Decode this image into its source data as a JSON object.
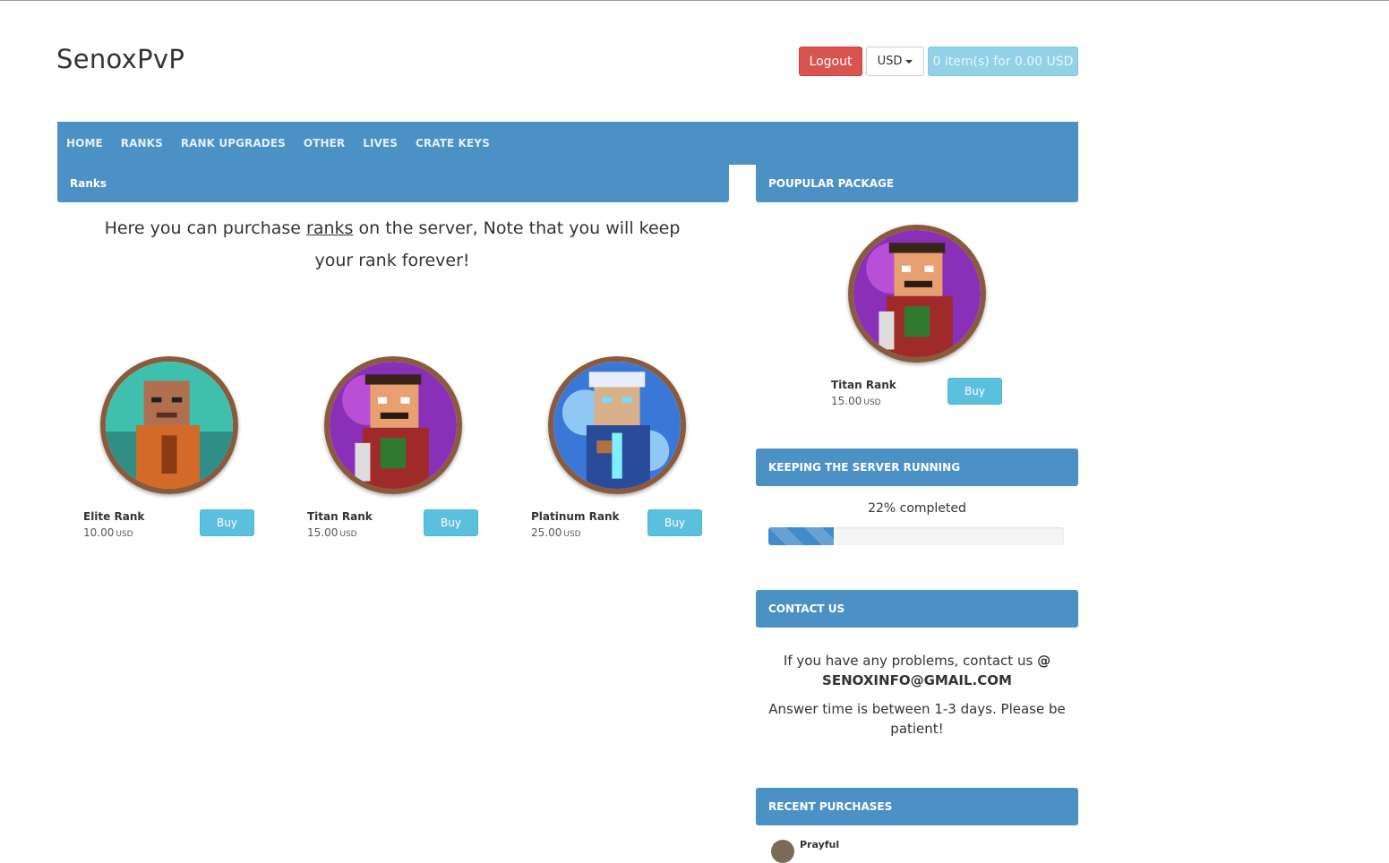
{
  "site": {
    "title": "SenoxPvP"
  },
  "header": {
    "logout_label": "Logout",
    "currency": "USD",
    "cart_label": "0 item(s) for 0.00 USD"
  },
  "nav": {
    "items": [
      {
        "label": "HOME"
      },
      {
        "label": "RANKS"
      },
      {
        "label": "RANK UPGRADES"
      },
      {
        "label": "OTHER"
      },
      {
        "label": "LIVES"
      },
      {
        "label": "CRATE KEYS"
      }
    ]
  },
  "main": {
    "heading": "Ranks",
    "intro_before": "Here you can purchase ",
    "intro_link": "ranks",
    "intro_after": " on the server, Note that you will keep your rank forever!",
    "packages": [
      {
        "name": "Elite Rank",
        "price": "10.00",
        "currency": "USD",
        "buy_label": "Buy",
        "icon": "elite-rank-icon"
      },
      {
        "name": "Titan Rank",
        "price": "15.00",
        "currency": "USD",
        "buy_label": "Buy",
        "icon": "titan-rank-icon"
      },
      {
        "name": "Platinum Rank",
        "price": "25.00",
        "currency": "USD",
        "buy_label": "Buy",
        "icon": "platinum-rank-icon"
      }
    ]
  },
  "sidebar": {
    "popular": {
      "heading": "POUPULAR PACKAGE",
      "name": "Titan Rank",
      "price": "15.00",
      "currency": "USD",
      "buy_label": "Buy"
    },
    "goal": {
      "heading": "KEEPING THE SERVER RUNNING",
      "label": "22% completed",
      "percent": 22
    },
    "contact": {
      "heading": "CONTACT US",
      "line1": "If you have any problems, contact us",
      "at": "@",
      "email": "SENOXINFO@GMAIL.COM",
      "line2": "Answer time is between 1-3 days. Please be patient!"
    },
    "recent": {
      "heading": "RECENT PURCHASES",
      "first_name": "Prayful"
    }
  },
  "colors": {
    "primary": "#4c91c6",
    "danger": "#d9534f",
    "info": "#5bc0de",
    "progress": "#428bca"
  }
}
